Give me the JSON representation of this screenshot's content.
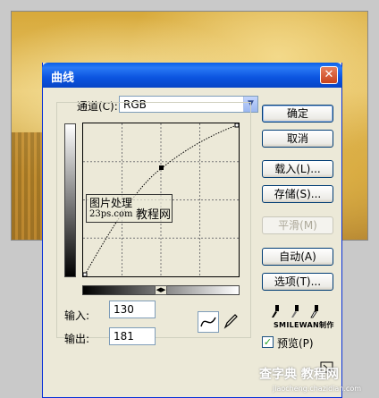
{
  "dialog": {
    "title": "曲线",
    "close_glyph": "✕",
    "channel_label": "通道(C):",
    "channel_value": "RGB",
    "input_label": "输入:",
    "input_value": "130",
    "output_label": "输出:",
    "output_value": "181",
    "preview_label": "预览(P)",
    "preview_checked": true
  },
  "buttons": {
    "ok": "确定",
    "cancel": "取消",
    "load": "载入(L)...",
    "save": "存储(S)...",
    "smooth": "平滑(M)",
    "auto": "自动(A)",
    "options": "选项(T)..."
  },
  "watermark": {
    "line1": "图片处理",
    "line2": "23ps.com",
    "line3": "教程网",
    "credit": "SMILEWAN制作"
  },
  "site_watermark": {
    "name": "查字典 教程网",
    "url": "jiaocheng.chazidian.com"
  },
  "icons": {
    "curve_tool": "curve-tool-icon",
    "pencil_tool": "pencil-tool-icon",
    "eyedropper": "eyedropper-icon",
    "resize": "resize-grip-icon"
  }
}
